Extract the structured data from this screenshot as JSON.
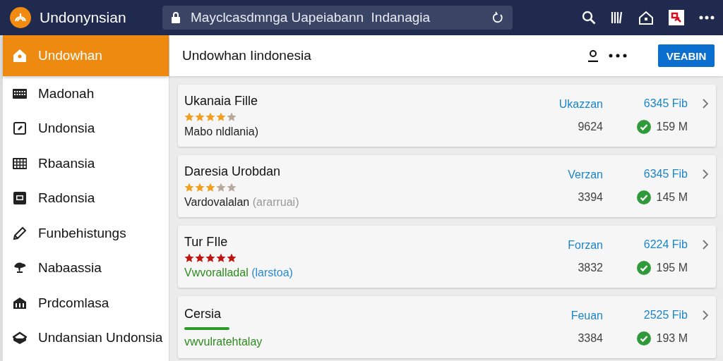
{
  "app": {
    "name": "Undonynsian"
  },
  "address_bar": {
    "value": "Mayclcasdmnga Uapeiabann  Indanagia"
  },
  "sidebar": {
    "items": [
      {
        "label": "Undowhan",
        "selected": true
      },
      {
        "label": "Madonah",
        "selected": false
      },
      {
        "label": "Undonsia",
        "selected": false
      },
      {
        "label": "Rbaansia",
        "selected": false
      },
      {
        "label": "Radonsia",
        "selected": false
      },
      {
        "label": "Funbehistungs",
        "selected": false
      },
      {
        "label": "Nabaassia",
        "selected": false
      },
      {
        "label": "Prdcomlasa",
        "selected": false
      },
      {
        "label": "Undansian Undonsia",
        "selected": false
      }
    ]
  },
  "header": {
    "title": "Undowhan Iindonesia",
    "button": "VEABIN"
  },
  "items": [
    {
      "kind": "stars",
      "title": "Ukanaia Fille",
      "stars": 4,
      "color": "#f0a020",
      "subtitle": "Mabo nldlania)",
      "link": false,
      "label": "Ukazzan",
      "size": "6345 Fib",
      "count": "9624",
      "status": "159 M"
    },
    {
      "kind": "stars",
      "title": "Daresia Urobdan",
      "stars": 3,
      "color": "#f0a020",
      "subtitle": "Vardovalalan",
      "note": "(ararruai)",
      "link": false,
      "label": "Verzan",
      "size": "6345 Fib",
      "count": "3394",
      "status": "145 M"
    },
    {
      "kind": "stars",
      "title": "Tur FIle",
      "stars": 5,
      "color": "#c0150f",
      "subtitle": "Vwvoralladal",
      "note": "(larstoa)",
      "link": true,
      "label": "Forzan",
      "size": "6224 Fib",
      "count": "3832",
      "status": "195 M"
    },
    {
      "kind": "underline",
      "title": "Cersia",
      "color": "#2e9a2a",
      "subtitle": "vwvulratehtalay",
      "link": true,
      "label": "Feuan",
      "size": "2525 Fib",
      "count": "3384",
      "status": "193 M"
    }
  ]
}
